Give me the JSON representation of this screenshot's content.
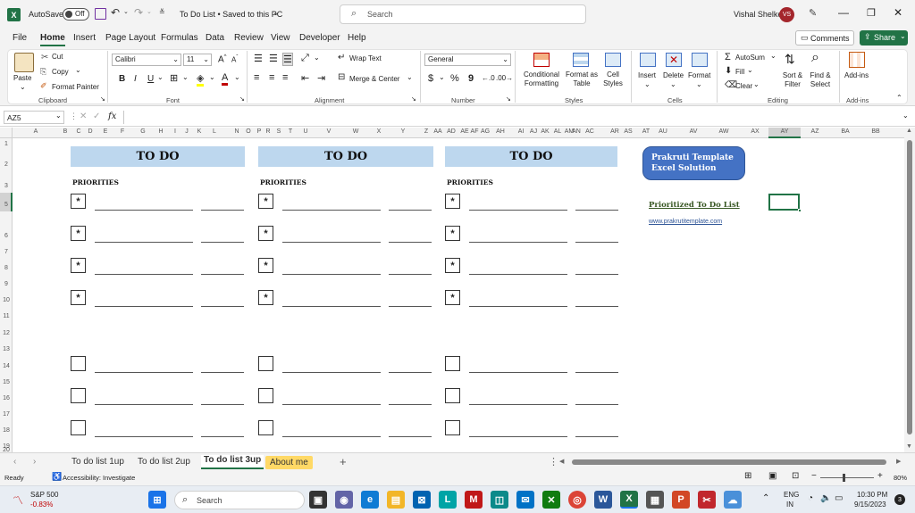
{
  "title_bar": {
    "app_icon": "excel-icon",
    "autosave_label": "AutoSave",
    "autosave_state": "Off",
    "document_title": "To Do List • Saved to this PC",
    "search_placeholder": "Search",
    "user_name": "Vishal Shelke",
    "user_initials": "VS"
  },
  "menu": [
    "File",
    "Home",
    "Insert",
    "Page Layout",
    "Formulas",
    "Data",
    "Review",
    "View",
    "Developer",
    "Help"
  ],
  "menu_active": "Home",
  "comments_label": "Comments",
  "share_label": "Share",
  "ribbon": {
    "clipboard": {
      "paste": "Paste",
      "cut": "Cut",
      "copy": "Copy",
      "format_painter": "Format Painter",
      "label": "Clipboard"
    },
    "font": {
      "name": "Calibri",
      "size": "11",
      "bold": "B",
      "italic": "I",
      "underline": "U",
      "label": "Font"
    },
    "alignment": {
      "wrap": "Wrap Text",
      "merge": "Merge & Center",
      "label": "Alignment"
    },
    "number": {
      "format": "General",
      "currency": "$",
      "percent": "%",
      "comma": "9",
      "label": "Number"
    },
    "styles": {
      "conditional": "Conditional Formatting",
      "table": "Format as Table",
      "cell_styles": "Cell Styles",
      "label": "Styles"
    },
    "cells": {
      "insert": "Insert",
      "delete": "Delete",
      "format": "Format",
      "label": "Cells"
    },
    "editing": {
      "autosum": "AutoSum",
      "fill": "Fill",
      "clear": "Clear",
      "sort": "Sort & Filter",
      "find": "Find & Select",
      "label": "Editing"
    },
    "addins": {
      "addins": "Add-ins",
      "label": "Add-ins"
    }
  },
  "formula_bar": {
    "name_box": "AZ5",
    "fx": "fx",
    "value": ""
  },
  "columns": [
    "A",
    "B",
    "C",
    "D",
    "E",
    "F",
    "G",
    "H",
    "I",
    "J",
    "K",
    "L",
    "N",
    "O",
    "P",
    "R",
    "S",
    "T",
    "U",
    "V",
    "W",
    "X",
    "Y",
    "Z",
    "AA",
    "AD",
    "AE",
    "AF",
    "AG",
    "AH",
    "AI",
    "AJ",
    "AK",
    "AL",
    "AM",
    "AN",
    "AC",
    "AR",
    "AS",
    "AT",
    "AU",
    "AV",
    "AW",
    "AX",
    "AY",
    "AZ",
    "BA",
    "BB",
    "BC"
  ],
  "rows": [
    "1",
    "2",
    "3",
    "5",
    "6",
    "7",
    "8",
    "9",
    "10",
    "11",
    "12",
    "13",
    "14",
    "15",
    "16",
    "17",
    "18",
    "19",
    "20"
  ],
  "sheet": {
    "todo_title": "TO DO",
    "priorities_label": "PRIORITIES",
    "priority_marker": "*",
    "brand_box": "Prakruti Template Excel Solution",
    "link_title": "Prioritized To Do List",
    "website": "www.prakrutitemplate.com",
    "brand_color": "#4472c4",
    "header_fill": "#bdd7ee"
  },
  "sheet_tabs": [
    "To do list 1up",
    "To do list 2up",
    "To do list 3up",
    "About me"
  ],
  "active_tab": "To do list 3up",
  "status_bar": {
    "ready": "Ready",
    "accessibility": "Accessibility: Investigate",
    "zoom": "80%"
  },
  "taskbar": {
    "stock_name": "S&P 500",
    "stock_change": "-0.83%",
    "search_placeholder": "Search",
    "lang_line1": "ENG",
    "lang_line2": "IN",
    "time": "10:30 PM",
    "date": "9/15/2023",
    "notification_count": "3"
  }
}
